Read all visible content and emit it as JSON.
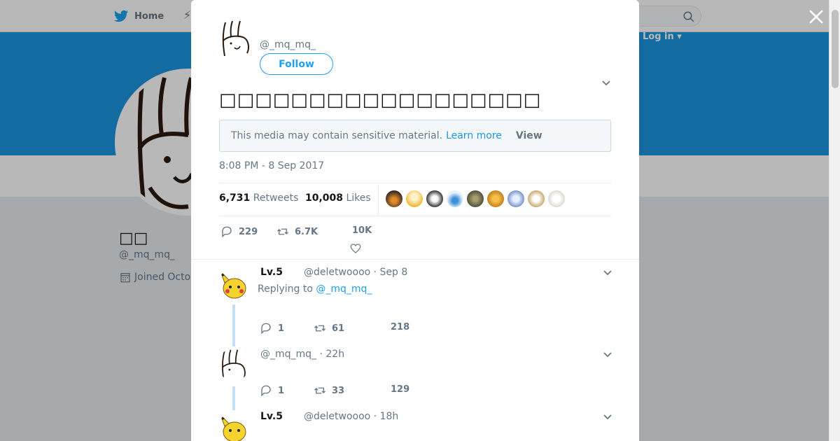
{
  "nav": {
    "home_label": "Home",
    "login_label": "Log in ▾"
  },
  "profile": {
    "name": "□□",
    "handle": "@_mq_mq_",
    "joined": "Joined Octo"
  },
  "modal": {
    "author_handle": "@_mq_mq_",
    "follow_label": "Follow",
    "tweet_text": "□□□□□□□□□□□□□□□□□□",
    "sensitive_notice": "This media may contain sensitive material.",
    "learn_more": "Learn more",
    "view_label": "View",
    "timestamp": "8:08 PM - 8 Sep 2017",
    "retweets_count": "6,731",
    "retweets_label": "Retweets",
    "likes_count": "10,008",
    "likes_label": "Likes",
    "reply_count": "229",
    "retweet_count_short": "6.7K",
    "like_count_short": "10K"
  },
  "replies": [
    {
      "name": "Lv.5",
      "meta": "@deletwoooo · Sep 8",
      "replying_prefix": "Replying to",
      "replying_to": "@_mq_mq_",
      "replies": "1",
      "retweets": "61",
      "likes": "218"
    },
    {
      "name": "",
      "meta": "@_mq_mq_ · 22h",
      "replies": "1",
      "retweets": "33",
      "likes": "129"
    },
    {
      "name": "Lv.5",
      "meta": "@deletwoooo · 18h"
    }
  ],
  "colors": {
    "accent": "#1da1f2",
    "banner": "#1b95e0",
    "muted": "#657786"
  },
  "icons": [
    "twitter-bird-icon",
    "search-icon",
    "close-icon",
    "chevron-down-icon",
    "reply-icon",
    "retweet-icon",
    "heart-icon",
    "calendar-icon"
  ]
}
